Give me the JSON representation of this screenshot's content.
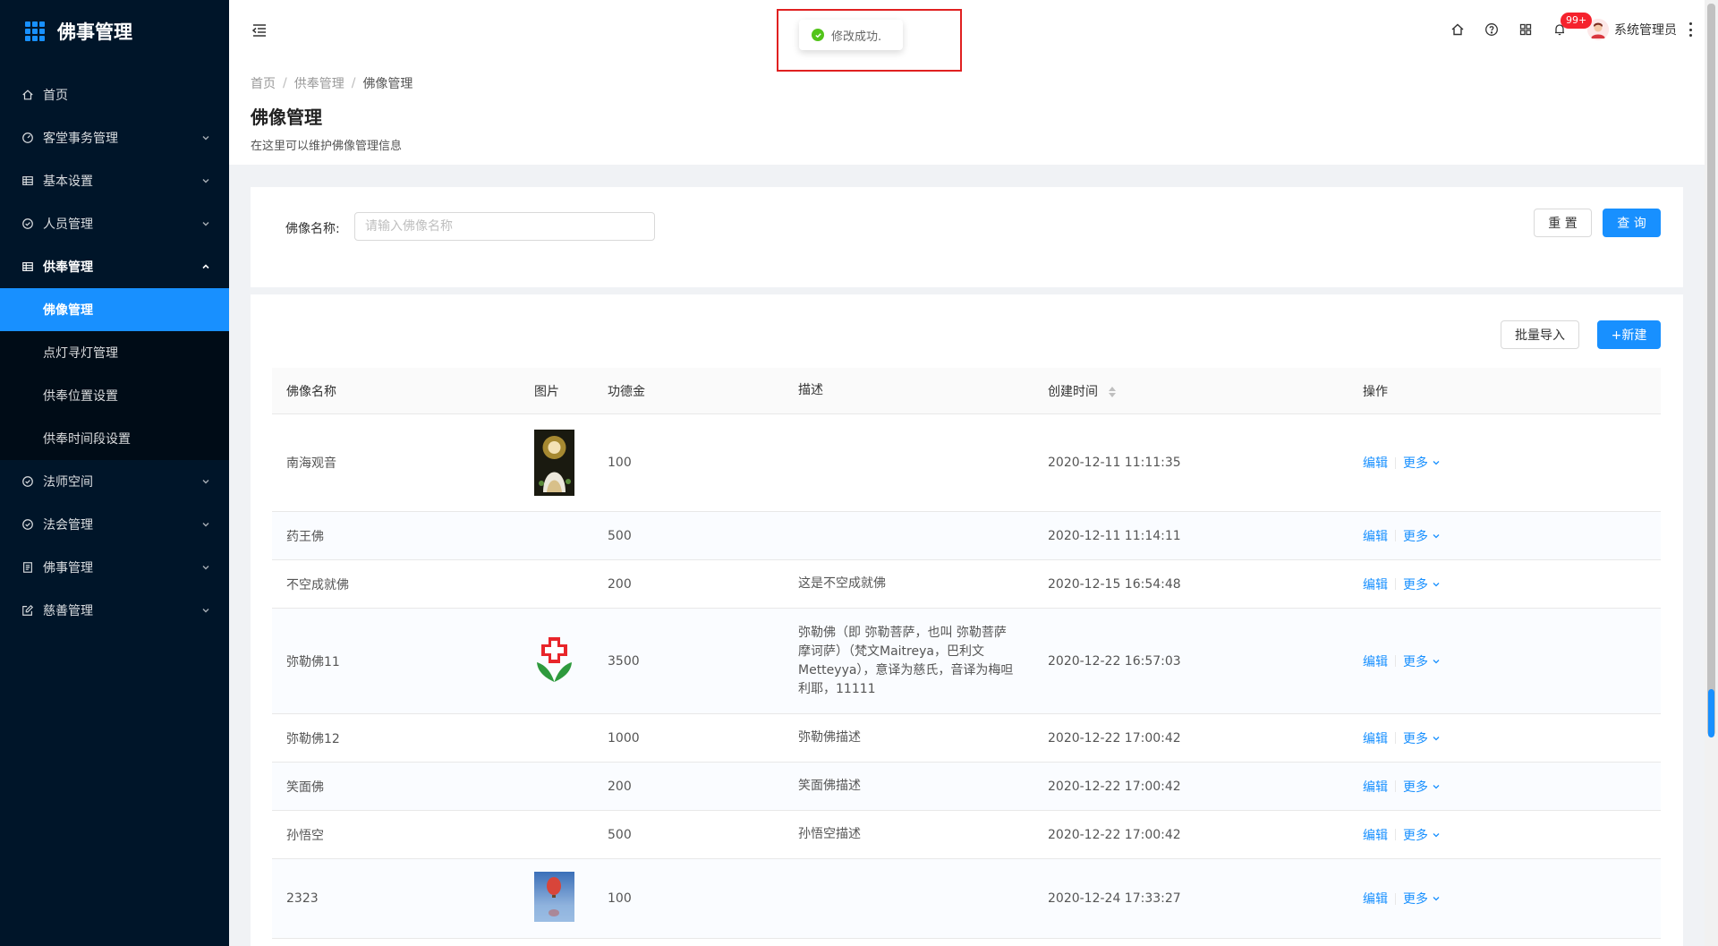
{
  "app": {
    "title": "佛事管理"
  },
  "sidebar": {
    "items": [
      {
        "label": "首页",
        "icon": "home-icon",
        "has_children": false
      },
      {
        "label": "客堂事务管理",
        "icon": "dashboard-icon",
        "has_children": true
      },
      {
        "label": "基本设置",
        "icon": "table-icon",
        "has_children": true
      },
      {
        "label": "人员管理",
        "icon": "check-circle-icon",
        "has_children": true
      },
      {
        "label": "供奉管理",
        "icon": "table-icon",
        "has_children": true,
        "open": true,
        "children": [
          {
            "label": "佛像管理",
            "active": true
          },
          {
            "label": "点灯寻灯管理"
          },
          {
            "label": "供奉位置设置"
          },
          {
            "label": "供奉时间段设置"
          }
        ]
      },
      {
        "label": "法师空间",
        "icon": "check-circle-icon",
        "has_children": true
      },
      {
        "label": "法会管理",
        "icon": "check-circle-icon",
        "has_children": true
      },
      {
        "label": "佛事管理",
        "icon": "profile-icon",
        "has_children": true
      },
      {
        "label": "慈善管理",
        "icon": "form-icon",
        "has_children": true
      }
    ]
  },
  "header": {
    "notifications_badge": "99+",
    "username": "系统管理员"
  },
  "toast": {
    "message": "修改成功."
  },
  "page": {
    "breadcrumb": [
      "首页",
      "供奉管理",
      "佛像管理"
    ],
    "title": "佛像管理",
    "description": "在这里可以维护佛像管理信息"
  },
  "search": {
    "label": "佛像名称:",
    "placeholder": "请输入佛像名称",
    "value": "",
    "reset_label": "重 置",
    "query_label": "查 询"
  },
  "toolbar": {
    "import_label": "批量导入",
    "new_label": "+新建"
  },
  "table": {
    "columns": [
      "佛像名称",
      "图片",
      "功德金",
      "描述",
      "创建时间",
      "操作"
    ],
    "edit_label": "编辑",
    "more_label": "更多",
    "rows": [
      {
        "name": "南海观音",
        "image": "guanyin",
        "amount": "100",
        "description": "",
        "created": "2020-12-11 11:11:35"
      },
      {
        "name": "药王佛",
        "image": "",
        "amount": "500",
        "description": "",
        "created": "2020-12-11 11:14:11"
      },
      {
        "name": "不空成就佛",
        "image": "",
        "amount": "200",
        "description": "这是不空成就佛",
        "created": "2020-12-15 16:54:48"
      },
      {
        "name": "弥勒佛11",
        "image": "charity-logo",
        "amount": "3500",
        "description": "弥勒佛（即 弥勒菩萨，也叫 弥勒菩萨摩诃萨）（梵文Maitreya，巴利文Metteyya），意译为慈氏，音译为梅呾利耶，11111",
        "created": "2020-12-22 16:57:03"
      },
      {
        "name": "弥勒佛12",
        "image": "",
        "amount": "1000",
        "description": "弥勒佛描述",
        "created": "2020-12-22 17:00:42"
      },
      {
        "name": "笑面佛",
        "image": "",
        "amount": "200",
        "description": "笑面佛描述",
        "created": "2020-12-22 17:00:42"
      },
      {
        "name": "孙悟空",
        "image": "",
        "amount": "500",
        "description": "孙悟空描述",
        "created": "2020-12-22 17:00:42"
      },
      {
        "name": "2323",
        "image": "balloon",
        "amount": "100",
        "description": "",
        "created": "2020-12-24 17:33:27"
      }
    ]
  },
  "colors": {
    "sidebar_bg": "#001529",
    "accent": "#1890ff",
    "success": "#52c41a",
    "badge": "#f5222d",
    "highlight_box": "#e02020"
  }
}
